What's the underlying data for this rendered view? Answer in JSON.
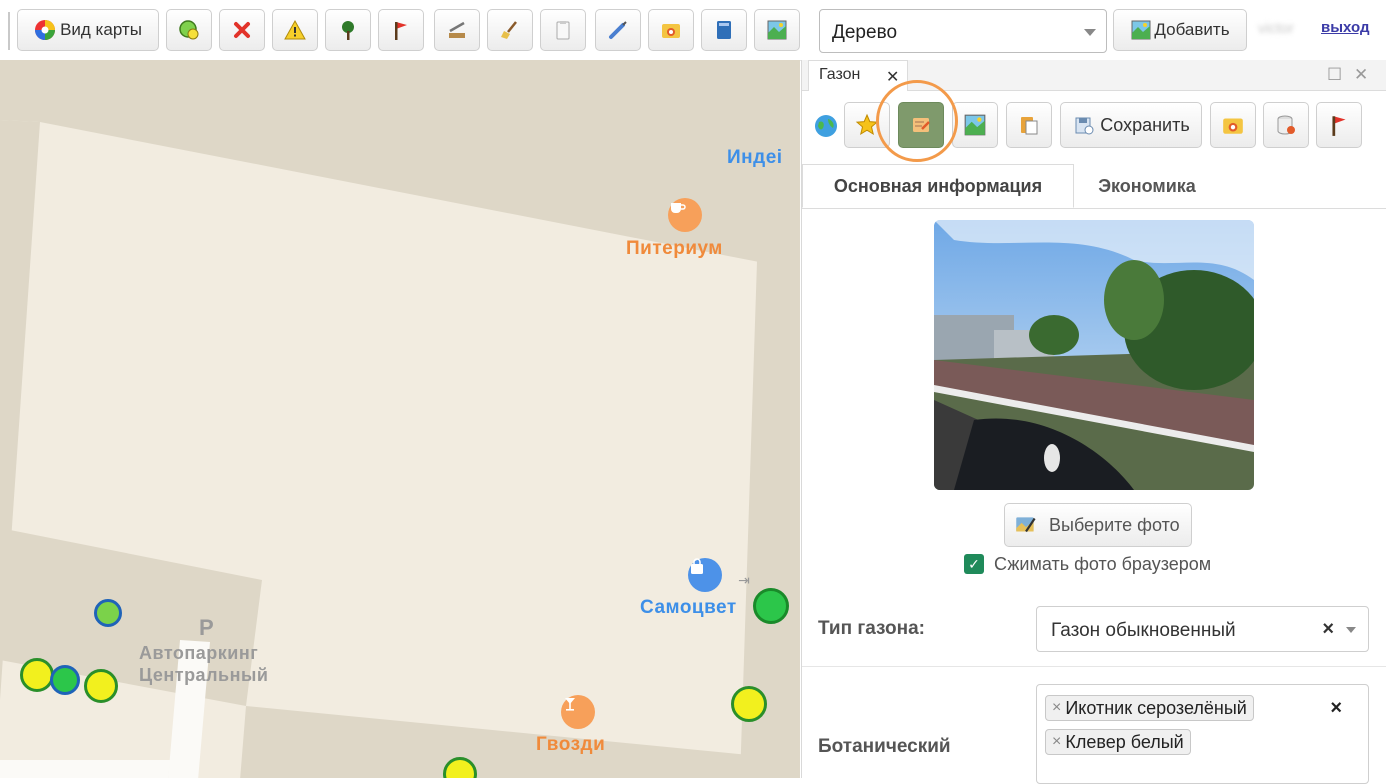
{
  "toolbar": {
    "map_view_label": "Вид карты",
    "icons": [
      "add-circle-icon",
      "delete-icon",
      "warning-icon",
      "tree-pin-icon",
      "flag-pin-icon",
      "cut-tree-icon",
      "sweep-icon",
      "clipboard-icon",
      "syringe-icon",
      "photo-folder-icon",
      "book-icon",
      "map-image-icon"
    ],
    "object_type_value": "Дерево",
    "add_label": "Добавить",
    "user_name": "victor",
    "logout_label": "выход"
  },
  "map": {
    "labels": {
      "indep": "Индеі",
      "piterium": "Питериум",
      "samocvet": "Самоцвет",
      "gvozdi": "Гвозди",
      "parking": "Автопаркинг\nЦентральный",
      "parking_letter": "P"
    }
  },
  "panel": {
    "tab_title": "Газон",
    "save_label": "Сохранить",
    "sections": [
      "Основная информация",
      "Экономика"
    ],
    "choose_photo_label": "Выберите фото",
    "compress_label": "Сжимать фото браузером",
    "lawn_type_label": "Тип газона:",
    "lawn_type_value": "Газон обыкновенный",
    "botanical_label": "Ботанический",
    "species": [
      "Икотник серозелёный",
      "Клевер белый"
    ]
  },
  "colors": {
    "accent_orange": "#f39a4a",
    "active_button": "#7f9a6c",
    "marker_green": "#2cc64a",
    "marker_yellow": "#f2f01e"
  }
}
